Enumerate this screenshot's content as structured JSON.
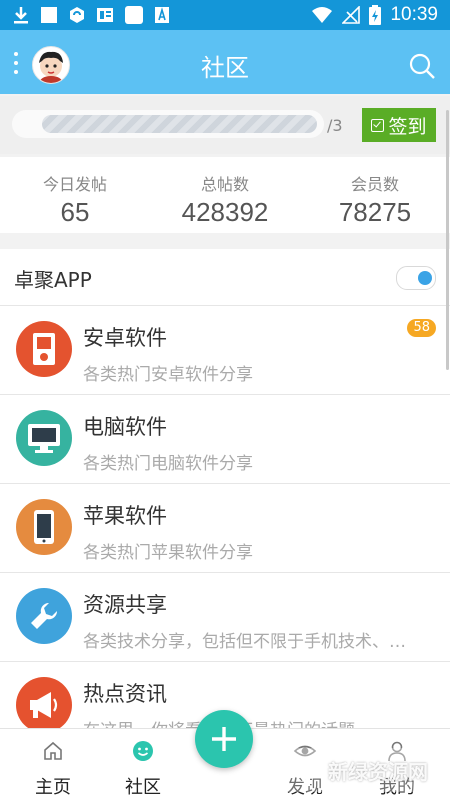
{
  "status_bar": {
    "time": "10:39",
    "left_icons": [
      "download-icon",
      "square-icon",
      "shield-icon",
      "news-icon",
      "square-icon",
      "font-icon"
    ],
    "right_icons": [
      "wifi-icon",
      "signal-off-icon",
      "battery-charging-icon"
    ]
  },
  "header": {
    "title": "社区",
    "background": "#5cc1f3"
  },
  "signin": {
    "progress_total": "/3",
    "button_label": "签到",
    "button_color": "#5aad26"
  },
  "stats": [
    {
      "label": "今日发帖",
      "value": "65"
    },
    {
      "label": "总帖数",
      "value": "428392"
    },
    {
      "label": "会员数",
      "value": "78275"
    }
  ],
  "section": {
    "title": "卓聚APP",
    "toggle_on": true
  },
  "forums": [
    {
      "name": "安卓软件",
      "desc": "各类热门安卓软件分享",
      "badge": "58",
      "icon": "android-device-icon",
      "color": "#e4532f"
    },
    {
      "name": "电脑软件",
      "desc": "各类热门电脑软件分享",
      "badge": "",
      "icon": "monitor-icon",
      "color": "#36b3a0"
    },
    {
      "name": "苹果软件",
      "desc": "各类热门苹果软件分享",
      "badge": "",
      "icon": "phone-icon",
      "color": "#e58b3f"
    },
    {
      "name": "资源共享",
      "desc": "各类技术分享，包括但不限于手机技术、…",
      "badge": "",
      "icon": "wrench-icon",
      "color": "#3fa3dc"
    },
    {
      "name": "热点资讯",
      "desc": "在这里，你将看到时下最热门的话题",
      "badge": "",
      "icon": "megaphone-icon",
      "color": "#e5522f"
    }
  ],
  "tabs": [
    {
      "label": "主页",
      "icon": "home-icon"
    },
    {
      "label": "社区",
      "icon": "smiley-icon",
      "active": true
    },
    {
      "label": "发现",
      "icon": "eye-icon"
    },
    {
      "label": "我的",
      "icon": "person-icon"
    }
  ],
  "fab": {
    "icon": "plus-icon",
    "color": "#2bc5ae"
  },
  "watermark": {
    "text": "新绿资源网",
    "subtext": "www.xlhsm.com"
  }
}
